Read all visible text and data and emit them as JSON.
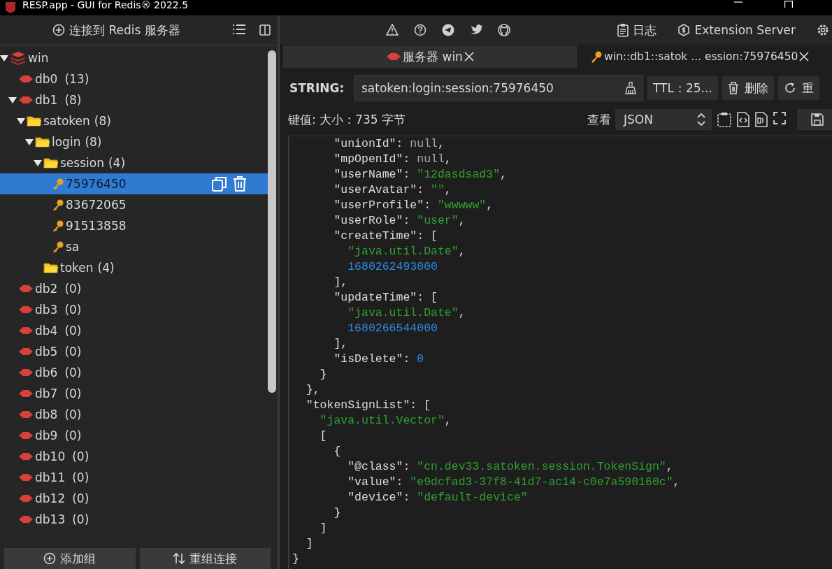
{
  "window": {
    "title": "RESP.app - GUI for Redis® 2022.5"
  },
  "sidebar": {
    "connect_button": "连接到 Redis 服务器",
    "tree": [
      {
        "kind": "server",
        "label": "win",
        "expanded": true,
        "selected": false,
        "children": [
          {
            "kind": "db",
            "label": "db0",
            "count": "(13)",
            "expanded": false,
            "selected": false
          },
          {
            "kind": "db",
            "label": "db1",
            "count": "(8)",
            "expanded": true,
            "selected": false,
            "children": [
              {
                "kind": "folder",
                "label": "satoken",
                "count": "(8)",
                "expanded": true,
                "selected": false,
                "children": [
                  {
                    "kind": "folder",
                    "label": "login",
                    "count": "(8)",
                    "expanded": true,
                    "selected": false,
                    "children": [
                      {
                        "kind": "folder",
                        "label": "session",
                        "count": "(4)",
                        "expanded": true,
                        "selected": false,
                        "children": [
                          {
                            "kind": "key",
                            "label": "75976450",
                            "selected": true
                          },
                          {
                            "kind": "key",
                            "label": "83672065",
                            "selected": false
                          },
                          {
                            "kind": "key",
                            "label": "91513858",
                            "selected": false
                          },
                          {
                            "kind": "key",
                            "label": "sa",
                            "selected": false
                          }
                        ]
                      },
                      {
                        "kind": "folder",
                        "label": "token",
                        "count": "(4)",
                        "expanded": false,
                        "selected": false
                      }
                    ]
                  }
                ]
              }
            ]
          },
          {
            "kind": "db",
            "label": "db2",
            "count": "(0)",
            "expanded": false,
            "selected": false
          },
          {
            "kind": "db",
            "label": "db3",
            "count": "(0)",
            "expanded": false,
            "selected": false
          },
          {
            "kind": "db",
            "label": "db4",
            "count": "(0)",
            "expanded": false,
            "selected": false
          },
          {
            "kind": "db",
            "label": "db5",
            "count": "(0)",
            "expanded": false,
            "selected": false
          },
          {
            "kind": "db",
            "label": "db6",
            "count": "(0)",
            "expanded": false,
            "selected": false
          },
          {
            "kind": "db",
            "label": "db7",
            "count": "(0)",
            "expanded": false,
            "selected": false
          },
          {
            "kind": "db",
            "label": "db8",
            "count": "(0)",
            "expanded": false,
            "selected": false
          },
          {
            "kind": "db",
            "label": "db9",
            "count": "(0)",
            "expanded": false,
            "selected": false
          },
          {
            "kind": "db",
            "label": "db10",
            "count": "(0)",
            "expanded": false,
            "selected": false
          },
          {
            "kind": "db",
            "label": "db11",
            "count": "(0)",
            "expanded": false,
            "selected": false
          },
          {
            "kind": "db",
            "label": "db12",
            "count": "(0)",
            "expanded": false,
            "selected": false
          },
          {
            "kind": "db",
            "label": "db13",
            "count": "(0)",
            "expanded": false,
            "selected": false
          }
        ]
      }
    ],
    "bottom_buttons": [
      {
        "kind": "add",
        "label": "添加组"
      },
      {
        "kind": "reorder",
        "label": "重组连接"
      }
    ]
  },
  "toolbar": {
    "log_button": "日志",
    "extension_button": "Extension Server"
  },
  "tabs": [
    {
      "kind": "server",
      "label": "服务器 win",
      "selected": false
    },
    {
      "kind": "key",
      "label": "win::db1::satok ... ession:75976450",
      "selected": true
    }
  ],
  "key_panel": {
    "type": "STRING:",
    "key_name": "satoken:login:session:75976450",
    "ttl_button": "TTL：25...",
    "delete_button": "删除",
    "reload_button": "重",
    "value_info": "键值: 大小：735 字节",
    "view_label": "查看",
    "view_format": "JSON"
  },
  "editor": {
    "lines": [
      [
        {
          "kind": "key",
          "text": "      \"unionId\""
        },
        {
          "kind": "punct",
          "text": ": "
        },
        {
          "kind": "null",
          "text": "null"
        },
        {
          "kind": "punct",
          "text": ","
        }
      ],
      [
        {
          "kind": "key",
          "text": "      \"mpOpenId\""
        },
        {
          "kind": "punct",
          "text": ": "
        },
        {
          "kind": "null",
          "text": "null"
        },
        {
          "kind": "punct",
          "text": ","
        }
      ],
      [
        {
          "kind": "key",
          "text": "      \"userName\""
        },
        {
          "kind": "punct",
          "text": ": "
        },
        {
          "kind": "string",
          "text": "\"12dasdsad3\""
        },
        {
          "kind": "punct",
          "text": ","
        }
      ],
      [
        {
          "kind": "key",
          "text": "      \"userAvatar\""
        },
        {
          "kind": "punct",
          "text": ": "
        },
        {
          "kind": "string",
          "text": "\"\""
        },
        {
          "kind": "punct",
          "text": ","
        }
      ],
      [
        {
          "kind": "key",
          "text": "      \"userProfile\""
        },
        {
          "kind": "punct",
          "text": ": "
        },
        {
          "kind": "string",
          "text": "\"wwwww\""
        },
        {
          "kind": "punct",
          "text": ","
        }
      ],
      [
        {
          "kind": "key",
          "text": "      \"userRole\""
        },
        {
          "kind": "punct",
          "text": ": "
        },
        {
          "kind": "string",
          "text": "\"user\""
        },
        {
          "kind": "punct",
          "text": ","
        }
      ],
      [
        {
          "kind": "key",
          "text": "      \"createTime\""
        },
        {
          "kind": "punct",
          "text": ": ["
        }
      ],
      [
        {
          "kind": "string",
          "text": "        \"java.util.Date\""
        },
        {
          "kind": "punct",
          "text": ","
        }
      ],
      [
        {
          "kind": "number",
          "text": "        1680262493000"
        }
      ],
      [
        {
          "kind": "punct",
          "text": "      ],"
        }
      ],
      [
        {
          "kind": "key",
          "text": "      \"updateTime\""
        },
        {
          "kind": "punct",
          "text": ": ["
        }
      ],
      [
        {
          "kind": "string",
          "text": "        \"java.util.Date\""
        },
        {
          "kind": "punct",
          "text": ","
        }
      ],
      [
        {
          "kind": "number",
          "text": "        1680266544000"
        }
      ],
      [
        {
          "kind": "punct",
          "text": "      ],"
        }
      ],
      [
        {
          "kind": "key",
          "text": "      \"isDelete\""
        },
        {
          "kind": "punct",
          "text": ": "
        },
        {
          "kind": "number",
          "text": "0"
        }
      ],
      [
        {
          "kind": "punct",
          "text": "    }"
        }
      ],
      [
        {
          "kind": "punct",
          "text": "  },"
        }
      ],
      [
        {
          "kind": "key",
          "text": "  \"tokenSignList\""
        },
        {
          "kind": "punct",
          "text": ": ["
        }
      ],
      [
        {
          "kind": "string",
          "text": "    \"java.util.Vector\""
        },
        {
          "kind": "punct",
          "text": ","
        }
      ],
      [
        {
          "kind": "punct",
          "text": "    ["
        }
      ],
      [
        {
          "kind": "punct",
          "text": "      {"
        }
      ],
      [
        {
          "kind": "key",
          "text": "        \"@class\""
        },
        {
          "kind": "punct",
          "text": ": "
        },
        {
          "kind": "string",
          "text": "\"cn.dev33.satoken.session.TokenSign\""
        },
        {
          "kind": "punct",
          "text": ","
        }
      ],
      [
        {
          "kind": "key",
          "text": "        \"value\""
        },
        {
          "kind": "punct",
          "text": ": "
        },
        {
          "kind": "string",
          "text": "\"e9dcfad3-37f8-41d7-ac14-c0e7a590160c\""
        },
        {
          "kind": "punct",
          "text": ","
        }
      ],
      [
        {
          "kind": "key",
          "text": "        \"device\""
        },
        {
          "kind": "punct",
          "text": ": "
        },
        {
          "kind": "string",
          "text": "\"default-device\""
        }
      ],
      [
        {
          "kind": "punct",
          "text": "      }"
        }
      ],
      [
        {
          "kind": "punct",
          "text": "    ]"
        }
      ],
      [
        {
          "kind": "punct",
          "text": "  ]"
        }
      ],
      [
        {
          "kind": "punct",
          "text": "}"
        }
      ]
    ]
  }
}
